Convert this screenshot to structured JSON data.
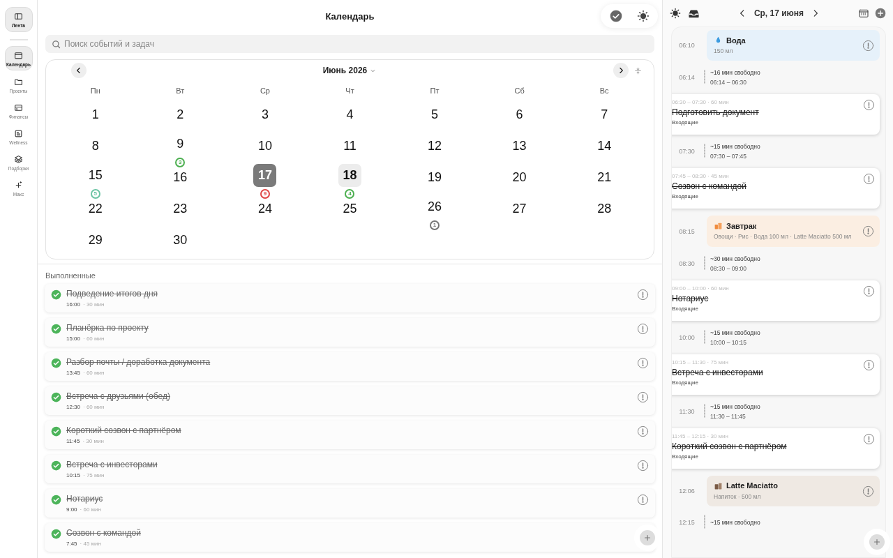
{
  "sidebar": {
    "top": {
      "label": "Лента"
    },
    "items": [
      {
        "label": "Календарь",
        "selected": true
      },
      {
        "label": "Проекты",
        "selected": false
      },
      {
        "label": "Финансы",
        "selected": false
      },
      {
        "label": "Wellness",
        "selected": false
      },
      {
        "label": "Подборки",
        "selected": false
      },
      {
        "label": "Макс",
        "selected": false
      }
    ]
  },
  "main": {
    "title": "Календарь",
    "search": {
      "placeholder": "Поиск событий и задач"
    },
    "calendar": {
      "month": "Июнь 2026",
      "weekdays": [
        "Пн",
        "Вт",
        "Ср",
        "Чт",
        "Пт",
        "Сб",
        "Вс"
      ],
      "days": [
        {
          "day": "1",
          "selected": false,
          "today": false
        },
        {
          "day": "2",
          "selected": false,
          "today": false
        },
        {
          "day": "3",
          "selected": false,
          "today": false
        },
        {
          "day": "4",
          "selected": false,
          "today": false
        },
        {
          "day": "5",
          "selected": false,
          "today": false
        },
        {
          "day": "6",
          "selected": false,
          "today": false
        },
        {
          "day": "7",
          "selected": false,
          "today": false
        },
        {
          "day": "8",
          "selected": false,
          "today": false
        },
        {
          "day": "9",
          "selected": false,
          "today": false,
          "badge": "3",
          "color": "#4caf50"
        },
        {
          "day": "10",
          "selected": false,
          "today": false
        },
        {
          "day": "11",
          "selected": false,
          "today": false
        },
        {
          "day": "12",
          "selected": false,
          "today": false
        },
        {
          "day": "13",
          "selected": false,
          "today": false
        },
        {
          "day": "14",
          "selected": false,
          "today": false
        },
        {
          "day": "15",
          "selected": false,
          "today": false,
          "badge": "5",
          "color": "#6cc4a4"
        },
        {
          "day": "16",
          "selected": false,
          "today": false
        },
        {
          "day": "17",
          "selected": true,
          "today": false,
          "badge": "9",
          "color": "#e04848"
        },
        {
          "day": "18",
          "selected": false,
          "today": true,
          "badge": "4",
          "color": "#4caf50"
        },
        {
          "day": "19",
          "selected": false,
          "today": false
        },
        {
          "day": "20",
          "selected": false,
          "today": false
        },
        {
          "day": "21",
          "selected": false,
          "today": false
        },
        {
          "day": "22",
          "selected": false,
          "today": false
        },
        {
          "day": "23",
          "selected": false,
          "today": false
        },
        {
          "day": "24",
          "selected": false,
          "today": false
        },
        {
          "day": "25",
          "selected": false,
          "today": false
        },
        {
          "day": "26",
          "selected": false,
          "today": false,
          "badge": "1",
          "color": "#777777"
        },
        {
          "day": "27",
          "selected": false,
          "today": false
        },
        {
          "day": "28",
          "selected": false,
          "today": false
        },
        {
          "day": "29",
          "selected": false,
          "today": false
        },
        {
          "day": "30",
          "selected": false,
          "today": false
        }
      ]
    },
    "completed": {
      "heading": "Выполненные",
      "items": [
        {
          "title": "Подведение итогов дня",
          "time": "16:00",
          "duration": "· 30 мин",
          "done": true
        },
        {
          "title": "Планёрка по проекту",
          "time": "15:00",
          "duration": "· 60 мин",
          "done": true
        },
        {
          "title": "Разбор почты / доработка документа",
          "time": "13:45",
          "duration": "· 60 мин",
          "done": true
        },
        {
          "title": "Встреча с друзьями (обед)",
          "time": "12:30",
          "duration": "· 60 мин",
          "done": true
        },
        {
          "title": "Короткий созвон с партнёром",
          "time": "11:45",
          "duration": "· 30 мин",
          "done": true
        },
        {
          "title": "Встреча с инвесторами",
          "time": "10:15",
          "duration": "· 75 мин",
          "done": true
        },
        {
          "title": "Нотариус",
          "time": "9:00",
          "duration": "· 60 мин",
          "done": true
        },
        {
          "title": "Созвон с командой",
          "time": "7:45",
          "duration": "· 45 мин",
          "done": true
        }
      ]
    }
  },
  "day_panel": {
    "date": "Ср, 17 июня",
    "entries": [
      {
        "kind": "water",
        "time": "06:10",
        "title": "Вода",
        "detail": "150 мл",
        "color": "#e6f1fa"
      },
      {
        "kind": "free",
        "time": "06:14",
        "title": "~16 мин свободно",
        "range": "06:14 – 06:30"
      },
      {
        "kind": "event",
        "range": "06:30 – 07:30 · 60 мин",
        "title": "Подготовить документ",
        "list": "Входящие"
      },
      {
        "kind": "free",
        "time": "07:30",
        "title": "~15 мин свободно",
        "range": "07:30 – 07:45"
      },
      {
        "kind": "event",
        "range": "07:45 – 08:30 · 45 мин",
        "title": "Созвон с командой",
        "list": "Входящие"
      },
      {
        "kind": "meal",
        "time": "08:15",
        "title": "Завтрак",
        "detail": "Овощи · Рис · Вода 100 мл · Latte Maciatto 500 мл",
        "color": "#fbeee2"
      },
      {
        "kind": "free",
        "time": "08:30",
        "title": "~30 мин свободно",
        "range": "08:30 – 09:00"
      },
      {
        "kind": "event",
        "range": "09:00 – 10:00 · 60 мин",
        "title": "Нотариус",
        "list": "Входящие"
      },
      {
        "kind": "free",
        "time": "10:00",
        "title": "~15 мин свободно",
        "range": "10:00 – 10:15"
      },
      {
        "kind": "event",
        "range": "10:15 – 11:30 · 75 мин",
        "title": "Встреча с инвесторами",
        "list": "Входящие"
      },
      {
        "kind": "free",
        "time": "11:30",
        "title": "~15 мин свободно",
        "range": "11:30 – 11:45"
      },
      {
        "kind": "event",
        "range": "11:45 – 12:15 · 30 мин",
        "title": "Короткий созвон с партнёром",
        "list": "Входящие"
      },
      {
        "kind": "drink",
        "time": "12:06",
        "title": "Latte Maciatto",
        "detail": "Напиток · 500 мл",
        "color": "#efe9e3"
      },
      {
        "kind": "free",
        "time": "12:15",
        "title": "~15 мин свободно"
      }
    ]
  }
}
